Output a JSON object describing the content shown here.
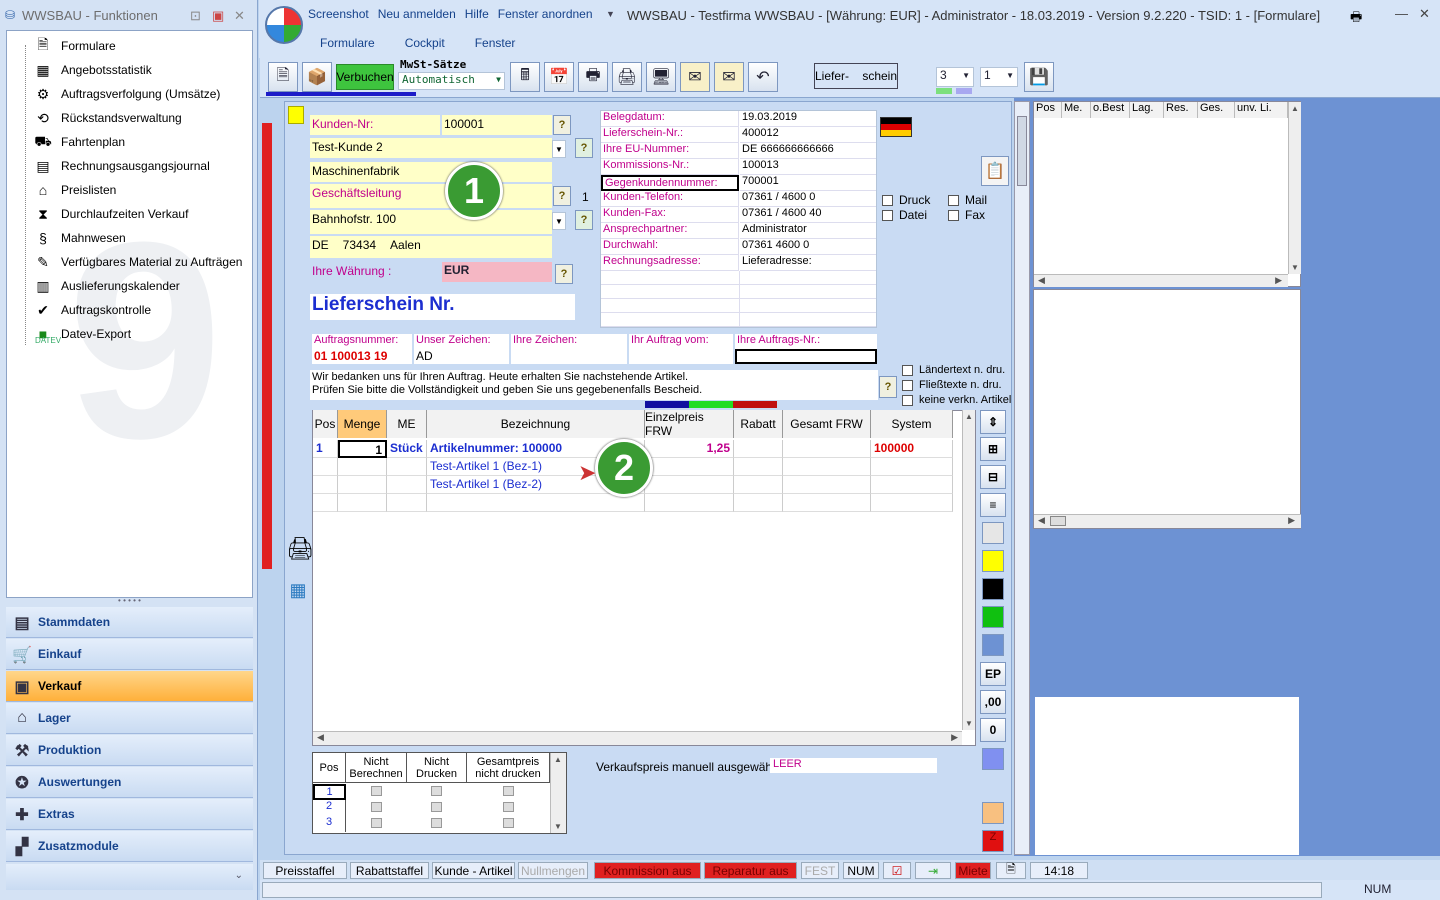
{
  "left_panel": {
    "title": "WWSBAU - Funktionen",
    "tree": [
      {
        "label": "Formulare",
        "icon": "form-icon"
      },
      {
        "label": "Angebotsstatistik",
        "icon": "calendar-chart-icon"
      },
      {
        "label": "Auftragsverfolgung (Umsätze)",
        "icon": "order-track-icon"
      },
      {
        "label": "Rückstandsverwaltung",
        "icon": "clock-back-icon"
      },
      {
        "label": "Fahrtenplan",
        "icon": "truck-icon"
      },
      {
        "label": "Rechnungsausgangsjournal",
        "icon": "journal-icon"
      },
      {
        "label": "Preislisten",
        "icon": "price-tag-icon"
      },
      {
        "label": "Durchlaufzeiten Verkauf",
        "icon": "hourglass-icon"
      },
      {
        "label": "Mahnwesen",
        "icon": "dunning-icon"
      },
      {
        "label": "Verfügbares Material zu Aufträgen",
        "icon": "material-icon"
      },
      {
        "label": "Auslieferungskalender",
        "icon": "calendar-icon"
      },
      {
        "label": "Auftragskontrolle",
        "icon": "clipboard-check-icon"
      },
      {
        "label": "Datev-Export",
        "icon": "datev-icon"
      }
    ],
    "datev_caption": "DATEV",
    "nav": [
      {
        "label": "Stammdaten",
        "icon": "master-data-icon"
      },
      {
        "label": "Einkauf",
        "icon": "cart-icon"
      },
      {
        "label": "Verkauf",
        "icon": "sales-icon"
      },
      {
        "label": "Lager",
        "icon": "warehouse-icon"
      },
      {
        "label": "Produktion",
        "icon": "production-icon"
      },
      {
        "label": "Auswertungen",
        "icon": "analytics-icon"
      },
      {
        "label": "Extras",
        "icon": "extras-icon"
      },
      {
        "label": "Zusatzmodule",
        "icon": "modules-icon"
      }
    ]
  },
  "quick_access": [
    "Screenshot",
    "Neu anmelden",
    "Hilfe",
    "Fenster anordnen"
  ],
  "window_title": "WWSBAU - Testfirma WWSBAU - [Währung: EUR] - Administrator - 18.03.2019 - Version 9.2.220 - TSID: 1  - [Formulare]",
  "menu": [
    "Formulare",
    "Cockpit",
    "Fenster"
  ],
  "toolbar": {
    "verbuchen": "Verbuchen",
    "mwst_label": "MwSt-Sätze",
    "mwst_value": "Automatisch",
    "lieferschein": "Liefer-    schein",
    "combo1": "3",
    "combo2": "1"
  },
  "customer": {
    "nr_label": "Kunden-Nr:",
    "nr_value": "100001",
    "name1": "Test-Kunde 2",
    "name2": "Maschinenfabrik",
    "contact": "Geschäftsleitung",
    "contact_count": "1",
    "street": "Bahnhofstr. 100",
    "country": "DE",
    "zip": "73434",
    "city": "Aalen",
    "currency_label": "Ihre Währung :",
    "currency_value": "EUR"
  },
  "doc_title": "Lieferschein  Nr.",
  "doc_info": [
    {
      "label": "Belegdatum:",
      "value": "19.03.2019"
    },
    {
      "label": "Lieferschein-Nr.:",
      "value": "400012"
    },
    {
      "label": "Ihre EU-Nummer:",
      "value": "DE 666666666666"
    },
    {
      "label": "Kommissions-Nr.:",
      "value": "100013"
    },
    {
      "label": "Gegenkundennummer:",
      "value": "700001"
    },
    {
      "label": "Kunden-Telefon:",
      "value": "07361 / 4600 0"
    },
    {
      "label": "Kunden-Fax:",
      "value": "07361 / 4600 40"
    },
    {
      "label": "Ansprechpartner:",
      "value": "Administrator"
    },
    {
      "label": "Durchwahl:",
      "value": "07361 4600 0"
    },
    {
      "label": "Rechnungsadresse:",
      "value": "Lieferadresse:"
    }
  ],
  "output_opts": {
    "druck": "Druck",
    "datei": "Datei",
    "mail": "Mail",
    "fax": "Fax"
  },
  "order_fields": [
    {
      "label": "Auftragsnummer:",
      "value": "01 100013 19"
    },
    {
      "label": "Unser Zeichen:",
      "value": "AD"
    },
    {
      "label": "Ihre Zeichen:",
      "value": ""
    },
    {
      "label": "Ihr Auftrag vom:",
      "value": ""
    },
    {
      "label": "Ihre Auftrags-Nr.:",
      "value": ""
    }
  ],
  "intro_text_1": "Wir bedanken uns für Ihren Auftrag. Heute erhalten Sie nachstehende Artikel.",
  "intro_text_2": "Prüfen Sie bitte die Vollständigkeit und geben Sie uns gegebenenfalls Bescheid.",
  "text_opts": [
    "Ländertext  n. dru.",
    "Fließtexte n. dru.",
    "keine verkn. Artikel"
  ],
  "grid": {
    "headers": [
      "Pos",
      "Menge",
      "ME",
      "Bezeichnung",
      "Einzelpreis FRW",
      "Rabatt",
      "Gesamt FRW",
      "System"
    ],
    "rows": [
      {
        "pos": "1",
        "menge": "1",
        "me": "Stück",
        "bez": "Artikelnummer: 100000",
        "ep": "1,25",
        "rabatt": "",
        "gesamt": "",
        "system": "100000"
      },
      {
        "pos": "",
        "menge": "",
        "me": "",
        "bez": "Test-Artikel 1  (Bez-1)",
        "ep": "",
        "rabatt": "",
        "gesamt": "",
        "system": ""
      },
      {
        "pos": "",
        "menge": "",
        "me": "",
        "bez": "Test-Artikel 1  (Bez-2)",
        "ep": "",
        "rabatt": "",
        "gesamt": "",
        "system": ""
      },
      {
        "pos": "",
        "menge": "",
        "me": "",
        "bez": "",
        "ep": "",
        "rabatt": "",
        "gesamt": "",
        "system": ""
      }
    ]
  },
  "badges": {
    "one": "1",
    "two": "2"
  },
  "sub_grid": {
    "headers": [
      "Pos",
      "Nicht Berechnen",
      "Nicht Drucken",
      "Gesamtpreis nicht drucken"
    ],
    "rows": [
      "1",
      "2",
      "3"
    ]
  },
  "manual_price_label": "Verkaufspreis manuell ausgewählt:",
  "manual_price_value": "LEER",
  "side_buttons": {
    "ep": "EP",
    "dec": ",00",
    "zero": "0",
    "z": "Z"
  },
  "mini_grid_headers": [
    "Pos",
    "Me.",
    "o.Best",
    "Lag.",
    "Res.",
    "Ges.",
    "unv. Li."
  ],
  "status_bar": [
    {
      "label": "Preisstaffel",
      "style": "normal"
    },
    {
      "label": "Rabattstaffel",
      "style": "normal"
    },
    {
      "label": "Kunde - Artikel",
      "style": "normal"
    },
    {
      "label": "Nullmengen",
      "style": "grey"
    },
    {
      "label": "Kommission aus",
      "style": "red"
    },
    {
      "label": "Reparatur aus",
      "style": "red"
    },
    {
      "label": "FEST",
      "style": "grey"
    },
    {
      "label": "NUM",
      "style": "normal"
    },
    {
      "label": "Miete",
      "style": "red"
    },
    {
      "label": "14:18",
      "style": "normal"
    }
  ],
  "bottom_status": {
    "num": "NUM"
  },
  "colors": {
    "accent": "#15428b",
    "label_magenta": "#c0008c",
    "red": "#e02020",
    "green_badge": "#3a9b33"
  }
}
